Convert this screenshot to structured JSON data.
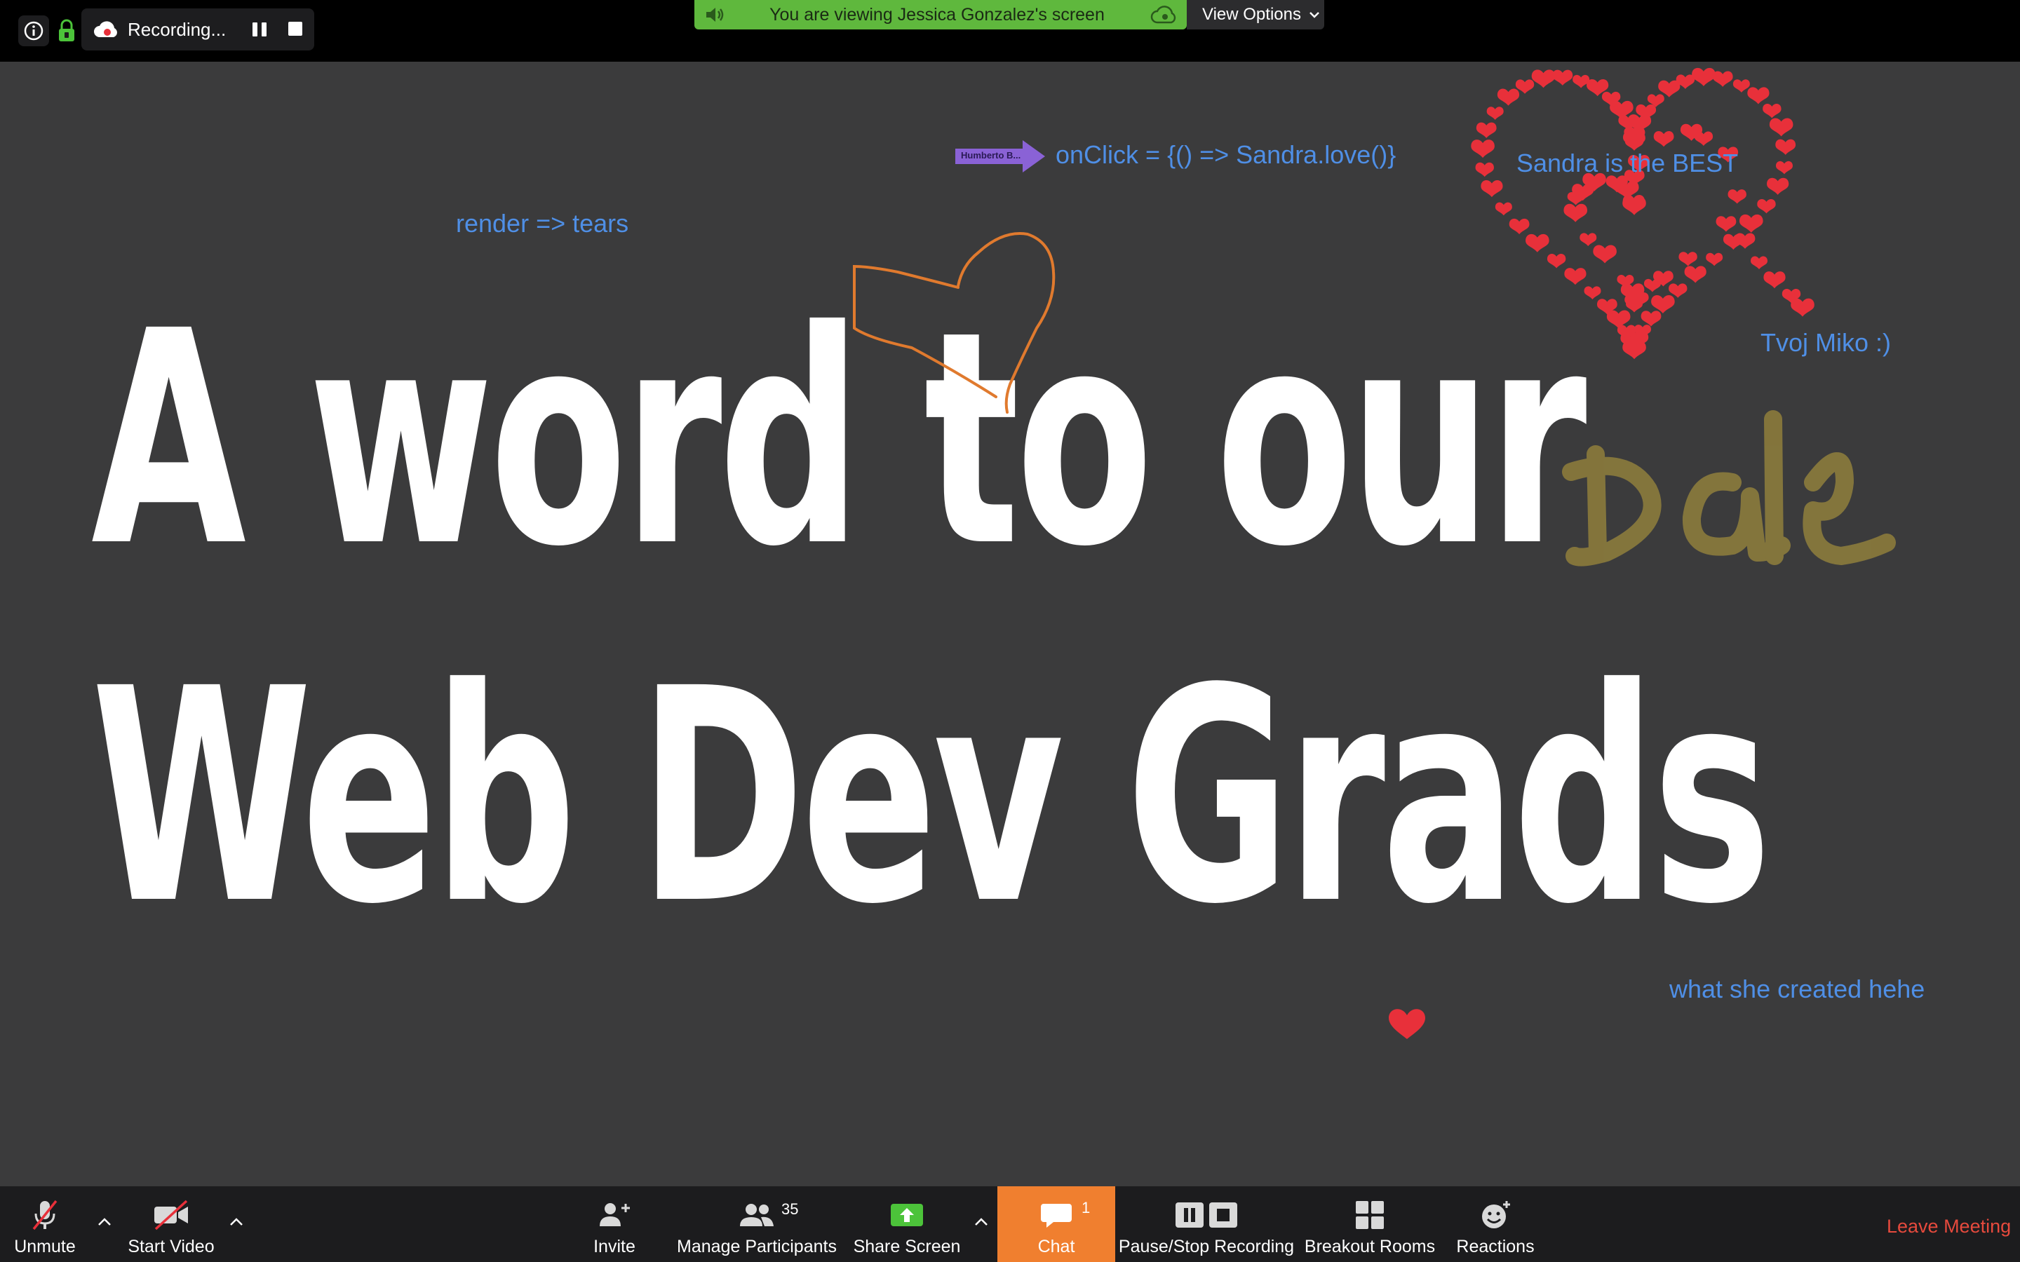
{
  "top_bar": {
    "recording_label": "Recording...",
    "viewing_banner": "You are viewing Jessica Gonzalez's screen",
    "view_options_label": "View Options"
  },
  "slide": {
    "title_line1": "A word to our",
    "title_line2": "Web Dev Grads"
  },
  "annotations": {
    "render_note": "render => tears",
    "onclick_note": "onClick = {() => Sandra.love()}",
    "sandra_note": "Sandra is the BEST",
    "miko_note": "Tvoj Miko :)",
    "created_note": "what she created hehe",
    "dale_handwriting": "Dale",
    "pointer_name_tag": "Humberto B..."
  },
  "toolbar": {
    "unmute_label": "Unmute",
    "start_video_label": "Start Video",
    "invite_label": "Invite",
    "manage_participants_label": "Manage Participants",
    "participants_count": "35",
    "share_screen_label": "Share Screen",
    "chat_label": "Chat",
    "chat_badge": "1",
    "pause_stop_label": "Pause/Stop Recording",
    "breakout_label": "Breakout Rooms",
    "reactions_label": "Reactions",
    "leave_label": "Leave Meeting"
  },
  "colors": {
    "banner_green": "#5fb83d",
    "chat_orange": "#f07f2f",
    "leave_red": "#e64a3d",
    "annotation_blue": "#4f8fe6",
    "heart_red": "#e8303a",
    "dale_olive": "#8a7a3c",
    "sketch_orange": "#e07a2e",
    "pointer_purple": "#8a62d6"
  },
  "icons": {
    "info": "info-icon",
    "lock": "lock-icon",
    "cloud_record": "cloud-record-icon",
    "pause": "pause-icon",
    "stop": "stop-icon",
    "speaker": "speaker-icon",
    "microphone_muted": "microphone-muted-icon",
    "video_off": "video-off-icon",
    "invite": "add-person-icon",
    "participants": "participants-icon",
    "share_screen": "share-screen-icon",
    "chat": "chat-icon",
    "breakout": "breakout-rooms-icon",
    "reactions": "reactions-icon"
  }
}
